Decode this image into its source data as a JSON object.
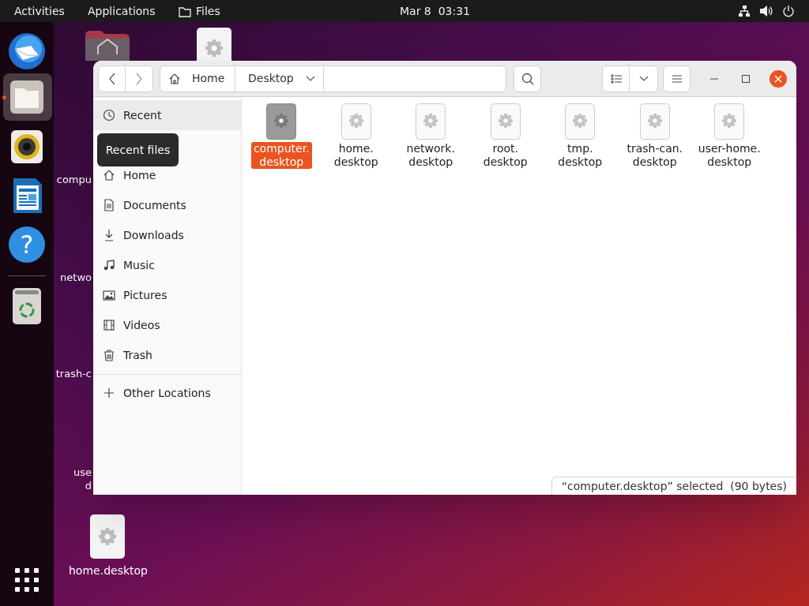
{
  "top_bar": {
    "activities": "Activities",
    "applications": "Applications",
    "app_menu": "Files",
    "clock": "Mar 8  03:31"
  },
  "dock": {
    "items": [
      {
        "kind": "mail",
        "running": false
      },
      {
        "kind": "files",
        "running": true
      },
      {
        "kind": "speaker",
        "running": false
      },
      {
        "kind": "document",
        "running": false
      },
      {
        "kind": "help",
        "glyph": "?",
        "running": false
      },
      {
        "kind": "trash",
        "running": false
      }
    ]
  },
  "desktop_icons": [
    {
      "kind": "home-folder"
    },
    {
      "kind": "gear"
    },
    {
      "kind": "label",
      "lines": [
        "compu"
      ]
    },
    {
      "kind": "label",
      "lines": [
        "netwo"
      ]
    },
    {
      "kind": "label",
      "lines": [
        "trash-c"
      ]
    },
    {
      "kind": "label",
      "lines": [
        "use",
        "d"
      ]
    },
    {
      "kind": "gear-labeled",
      "lines": [
        "home.desktop"
      ]
    }
  ],
  "window": {
    "toolbar": {
      "path": [
        {
          "label": "Home",
          "kind": "home",
          "current": false
        },
        {
          "label": "Desktop",
          "kind": "folder",
          "current": true
        }
      ]
    },
    "sidebar": {
      "items": [
        {
          "label": "Recent",
          "kind": "recent",
          "selected": true
        },
        {
          "label": "Home",
          "kind": "home",
          "selected": false
        },
        {
          "label": "Documents",
          "kind": "documents",
          "selected": false
        },
        {
          "label": "Downloads",
          "kind": "downloads",
          "selected": false
        },
        {
          "label": "Music",
          "kind": "music",
          "selected": false
        },
        {
          "label": "Pictures",
          "kind": "pictures",
          "selected": false
        },
        {
          "label": "Videos",
          "kind": "videos",
          "selected": false
        },
        {
          "label": "Trash",
          "kind": "trash",
          "selected": false
        }
      ],
      "other_locations": "Other Locations",
      "tooltip": "Recent files"
    },
    "files": [
      {
        "lines": [
          "computer.",
          "desktop"
        ],
        "selected": true
      },
      {
        "lines": [
          "home.",
          "desktop"
        ],
        "selected": false
      },
      {
        "lines": [
          "network.",
          "desktop"
        ],
        "selected": false
      },
      {
        "lines": [
          "root.",
          "desktop"
        ],
        "selected": false
      },
      {
        "lines": [
          "tmp.",
          "desktop"
        ],
        "selected": false
      },
      {
        "lines": [
          "trash-can.",
          "desktop"
        ],
        "selected": false
      },
      {
        "lines": [
          "user-home.",
          "desktop"
        ],
        "selected": false
      }
    ],
    "status": "“computer.desktop” selected  (90 bytes)"
  }
}
